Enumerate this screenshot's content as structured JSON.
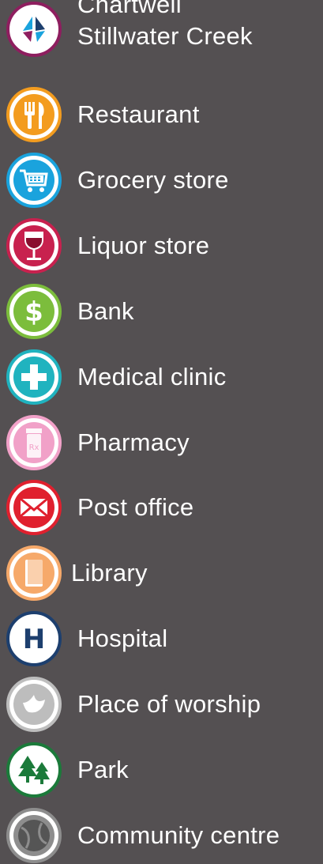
{
  "legend": {
    "items": [
      {
        "label": "Chartwell\nStillwater Creek",
        "icon": "chartwell-logo-icon",
        "color": "#8e1e5f"
      },
      {
        "label": "Restaurant",
        "icon": "fork-knife-icon",
        "color": "#f39c1f"
      },
      {
        "label": "Grocery store",
        "icon": "shopping-cart-icon",
        "color": "#1aa3dd"
      },
      {
        "label": "Liquor store",
        "icon": "wine-glass-icon",
        "color": "#c8214e"
      },
      {
        "label": "Bank",
        "icon": "dollar-icon",
        "color": "#7cbd3c"
      },
      {
        "label": "Medical clinic",
        "icon": "medical-cross-icon",
        "color": "#20b3bf"
      },
      {
        "label": "Pharmacy",
        "icon": "pill-bottle-icon",
        "color": "#f1a1c8"
      },
      {
        "label": "Post office",
        "icon": "envelope-icon",
        "color": "#e0202e"
      },
      {
        "label": "Library",
        "icon": "book-icon",
        "color": "#f6a96a"
      },
      {
        "label": "Hospital",
        "icon": "hospital-h-icon",
        "color": "#1d3f6e"
      },
      {
        "label": "Place of worship",
        "icon": "dove-icon",
        "color": "#bdbdbd"
      },
      {
        "label": "Park",
        "icon": "pine-trees-icon",
        "color": "#1b7a3a"
      },
      {
        "label": "Community centre",
        "icon": "tennis-ball-icon",
        "color": "#8d8d8d"
      }
    ]
  }
}
